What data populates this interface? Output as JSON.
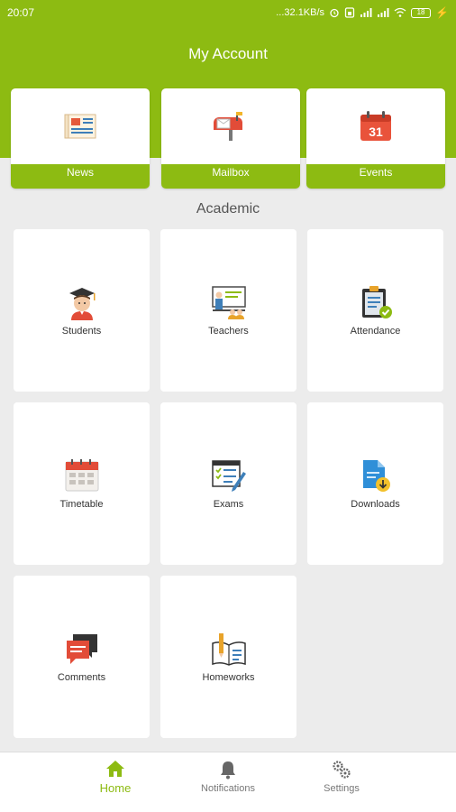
{
  "status_bar": {
    "time": "20:07",
    "net_speed": "...32.1KB/s",
    "battery": "18"
  },
  "header": {
    "title": "My Account"
  },
  "quick_links": [
    {
      "label": "News",
      "icon": "newspaper-icon"
    },
    {
      "label": "Mailbox",
      "icon": "mailbox-icon"
    },
    {
      "label": "Events",
      "icon": "calendar-icon",
      "icon_text": "31"
    }
  ],
  "section": {
    "title": "Academic"
  },
  "tiles": [
    {
      "label": "Students",
      "icon": "student-icon"
    },
    {
      "label": "Teachers",
      "icon": "teacher-icon"
    },
    {
      "label": "Attendance",
      "icon": "clipboard-check-icon"
    },
    {
      "label": "Timetable",
      "icon": "timetable-icon"
    },
    {
      "label": "Exams",
      "icon": "exam-icon"
    },
    {
      "label": "Downloads",
      "icon": "download-file-icon"
    },
    {
      "label": "Comments",
      "icon": "comments-icon"
    },
    {
      "label": "Homeworks",
      "icon": "homework-icon"
    }
  ],
  "bottom_nav": [
    {
      "label": "Home",
      "icon": "home-icon",
      "active": true
    },
    {
      "label": "Notifications",
      "icon": "bell-icon",
      "active": false
    },
    {
      "label": "Settings",
      "icon": "gears-icon",
      "active": false
    }
  ],
  "colors": {
    "accent": "#8dbb12",
    "background": "#ececec"
  }
}
